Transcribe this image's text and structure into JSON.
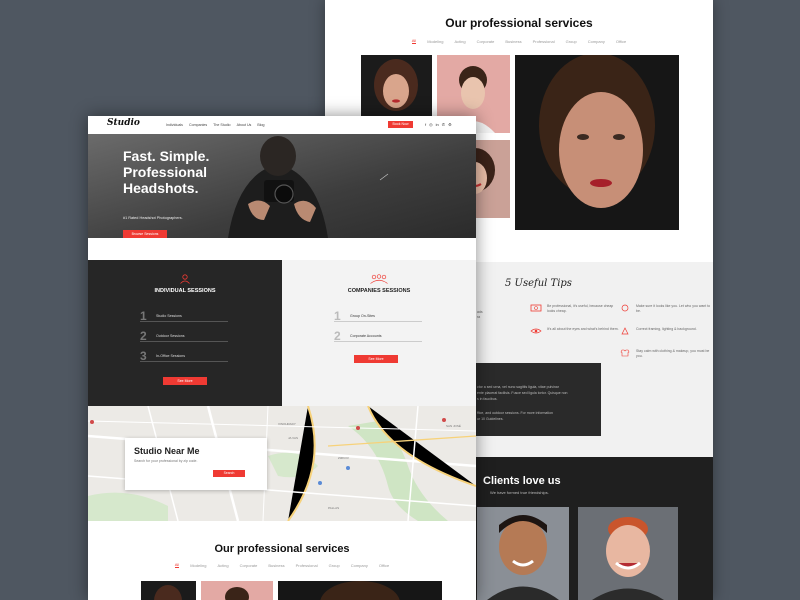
{
  "back": {
    "services_title": "Our professional services",
    "filters": [
      "All",
      "Modeling",
      "Acting",
      "Corporate",
      "Business",
      "Professional",
      "Group",
      "Company",
      "Office"
    ],
    "tips": {
      "title": "5 Useful Tips",
      "items": [
        "Be professional, it's useful, because cheap looks cheap.",
        "It's all about the eyes and what's behind them.",
        "Make sure it looks like you. Let who you want to be.",
        "Correct framing, lighting & background.",
        "Stay calm with clothing & makeup, you must be you."
      ],
      "cut_text": [
        "ads",
        "ra"
      ],
      "info_lines": [
        "ctor a sed urna, vel nunc sagittis ligula, vitae pulvinar",
        "ente placerat facilisis. Fusce sed ligula tortor. Quisque non",
        "s in faucibus.",
        "ffice, and outdoor sessions. For more information",
        "ur 10 Guidelines."
      ]
    },
    "clients": {
      "title": "Clients love us",
      "subtitle": "We have formed true friendships."
    }
  },
  "front": {
    "nav": {
      "logo": "Studio",
      "menu": [
        "Individuals",
        "Companies",
        "The Studio",
        "About Us",
        "Blog"
      ],
      "book_label": "Book Now",
      "social": [
        "f",
        "◎",
        "in",
        "✆",
        "⚙"
      ]
    },
    "hero": {
      "title": "Fast. Simple. Professional Headshots.",
      "tagline": "#1 Rated Headshot Photographers.",
      "cta": "Browse Sessions"
    },
    "individual": {
      "title": "INDIVIDUAL SESSIONS",
      "items": [
        "Studio Sessions",
        "Outdoor Sessions",
        "In-Office Sessions"
      ],
      "button": "See More"
    },
    "companies": {
      "title": "COMPANIES SESSIONS",
      "items": [
        "Group On-Sites",
        "Corporate Accounts"
      ],
      "button": "See More"
    },
    "map": {
      "title": "Studio Near Me",
      "subtitle": "Search for your professional by zip code.",
      "button": "Search",
      "labels": [
        "SAN JOSÉ",
        "JA VAS",
        "ZIZKOV",
        "PALLAS",
        "VINOHRADY"
      ]
    },
    "services_title": "Our professional services",
    "filters": [
      "All",
      "Modeling",
      "Acting",
      "Corporate",
      "Business",
      "Professional",
      "Group",
      "Company",
      "Office"
    ]
  },
  "colors": {
    "accent": "#ef3a33",
    "dark": "#262626",
    "background": "#4f5761"
  }
}
